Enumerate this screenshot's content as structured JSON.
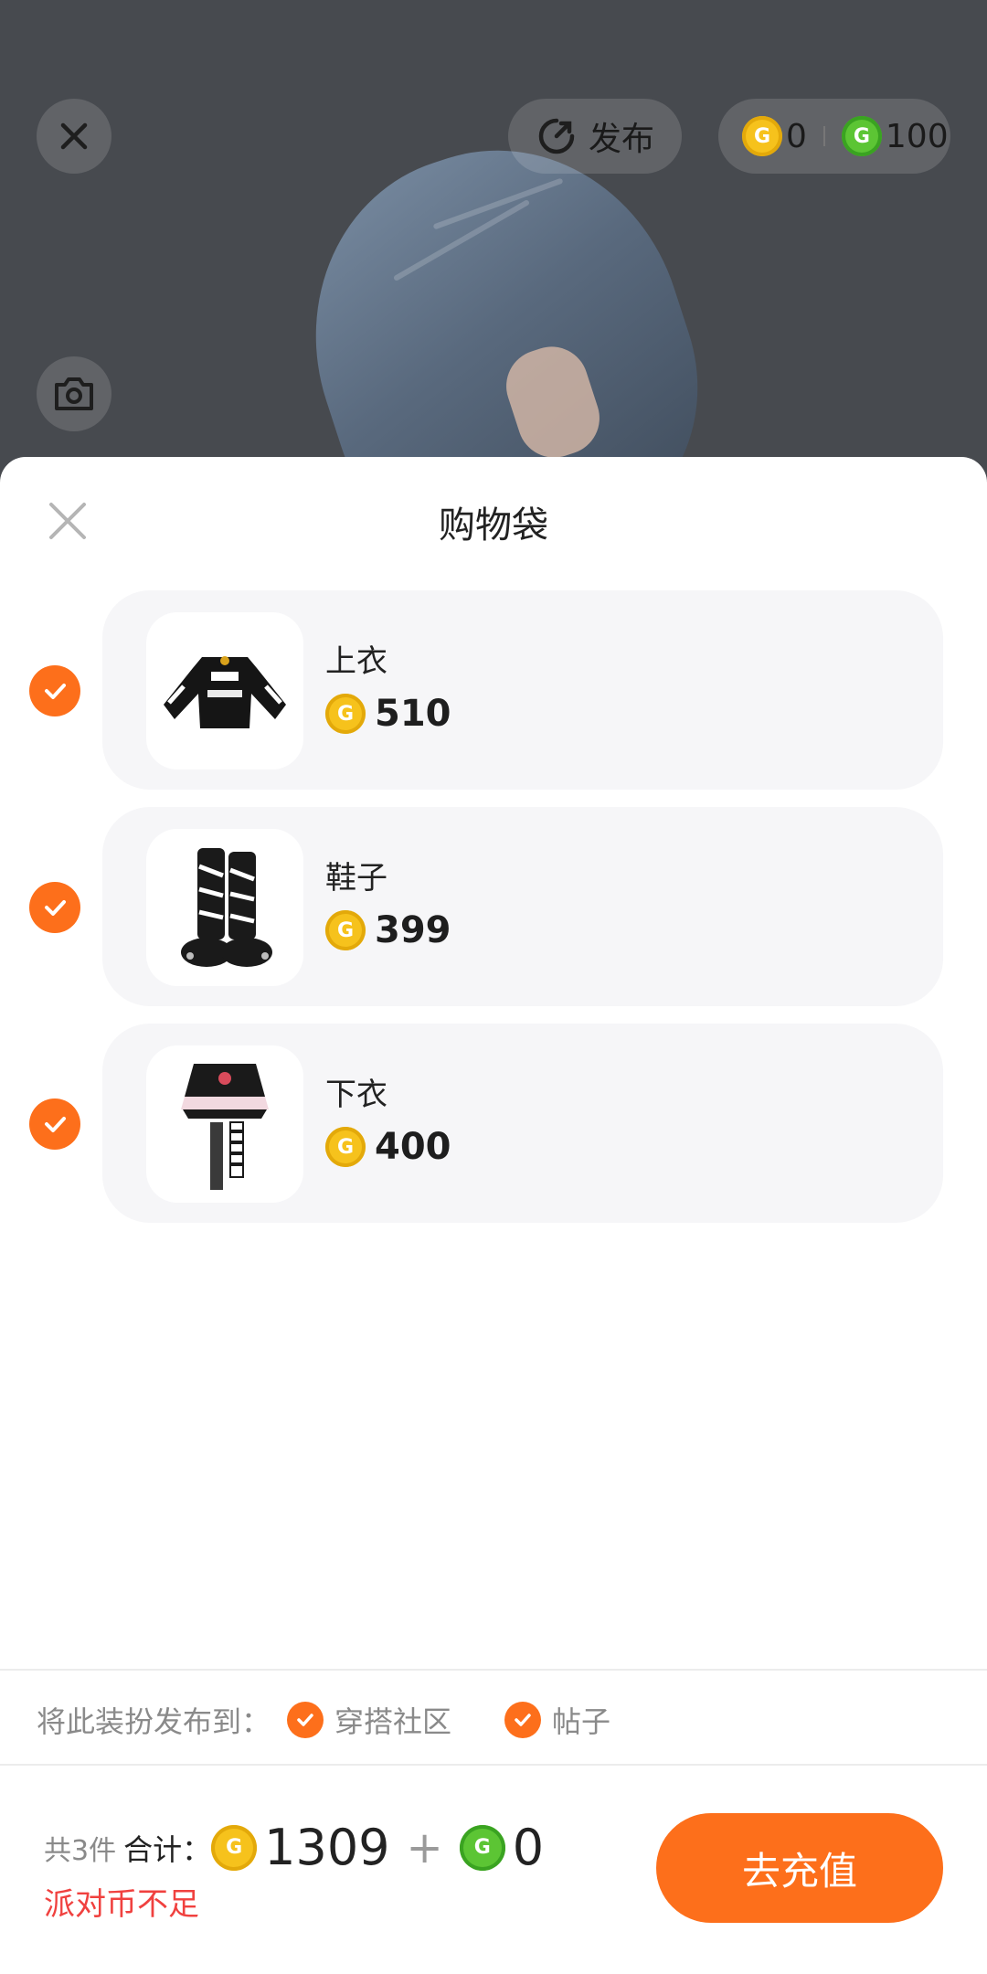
{
  "header": {
    "publish_label": "发布",
    "gold_balance": "0",
    "green_balance": "100"
  },
  "sheet": {
    "title": "购物袋",
    "items": [
      {
        "name": "上衣",
        "price": "510",
        "checked": true,
        "thumb_icon": "jacket-icon"
      },
      {
        "name": "鞋子",
        "price": "399",
        "checked": true,
        "thumb_icon": "boots-icon"
      },
      {
        "name": "下衣",
        "price": "400",
        "checked": true,
        "thumb_icon": "skirt-icon"
      }
    ]
  },
  "publish": {
    "label": "将此装扮发布到：",
    "options": [
      {
        "label": "穿搭社区",
        "checked": true
      },
      {
        "label": "帖子",
        "checked": true
      }
    ]
  },
  "footer": {
    "count_text": "共3件",
    "sum_label": "合计：",
    "gold_total": "1309",
    "plus": "+",
    "green_total": "0",
    "warning": "派对币不足",
    "recharge_label": "去充值"
  },
  "colors": {
    "accent": "#fd6f1b",
    "warning": "#f0413f",
    "gold_coin": "#f6c21c",
    "green_coin": "#5cc534"
  }
}
